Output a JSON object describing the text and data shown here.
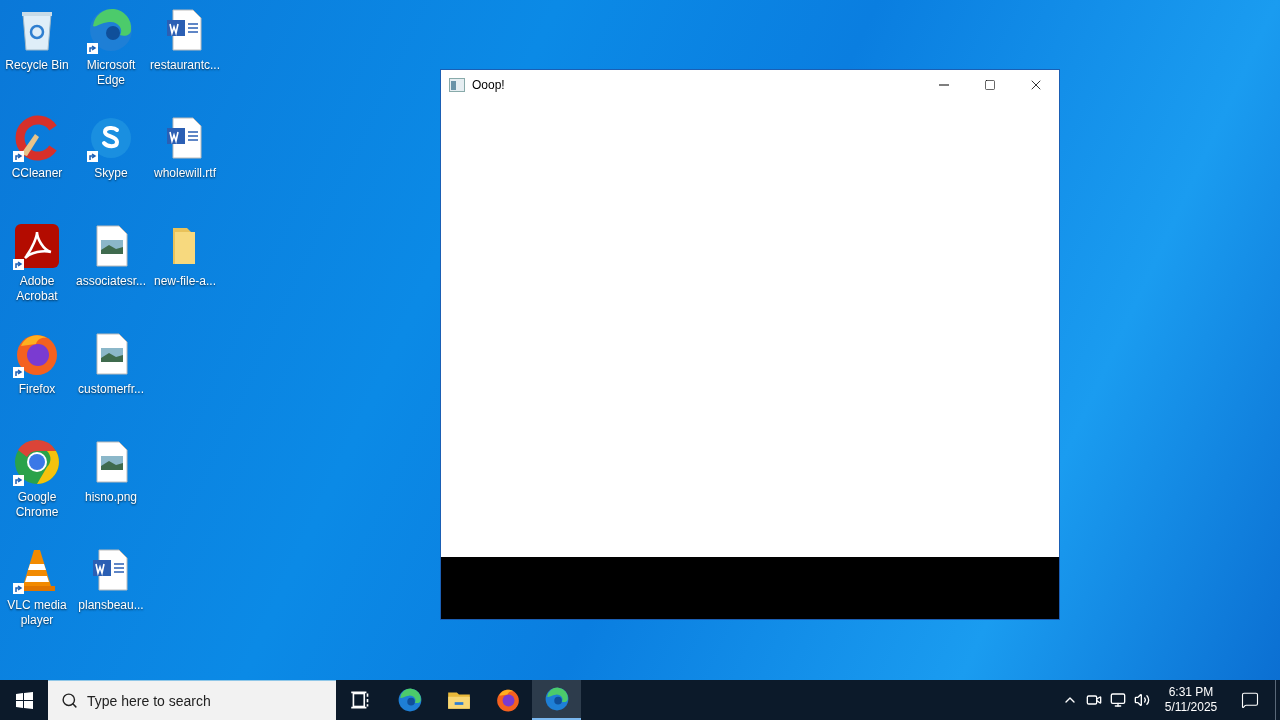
{
  "desktop_icons": [
    {
      "label": "Recycle Bin",
      "kind": "recycle",
      "shortcut": false
    },
    {
      "label": "CCleaner",
      "kind": "ccleaner",
      "shortcut": true
    },
    {
      "label": "Adobe Acrobat",
      "kind": "acrobat",
      "shortcut": true
    },
    {
      "label": "Firefox",
      "kind": "firefox",
      "shortcut": true
    },
    {
      "label": "Google Chrome",
      "kind": "chrome",
      "shortcut": true
    },
    {
      "label": "VLC media player",
      "kind": "vlc",
      "shortcut": true
    },
    {
      "label": "Microsoft Edge",
      "kind": "edge",
      "shortcut": true
    },
    {
      "label": "Skype",
      "kind": "skype",
      "shortcut": true
    },
    {
      "label": "associatesr...",
      "kind": "image",
      "shortcut": false
    },
    {
      "label": "customerfr...",
      "kind": "image",
      "shortcut": false
    },
    {
      "label": "hisno.png",
      "kind": "image",
      "shortcut": false
    },
    {
      "label": "plansbeau...",
      "kind": "word",
      "shortcut": false
    },
    {
      "label": "restaurantc...",
      "kind": "word",
      "shortcut": false
    },
    {
      "label": "wholewill.rtf",
      "kind": "word",
      "shortcut": false
    },
    {
      "label": "new-file-a...",
      "kind": "folder",
      "shortcut": false
    }
  ],
  "window": {
    "title": "Ooop!"
  },
  "taskbar": {
    "search": {
      "placeholder": "Type here to search"
    },
    "apps": [
      {
        "kind": "taskview",
        "selected": false
      },
      {
        "kind": "edge",
        "selected": false
      },
      {
        "kind": "explorer",
        "selected": false
      },
      {
        "kind": "firefox",
        "selected": false
      },
      {
        "kind": "edge",
        "selected": true
      }
    ],
    "time": "6:31 PM",
    "date": "5/11/2025"
  }
}
